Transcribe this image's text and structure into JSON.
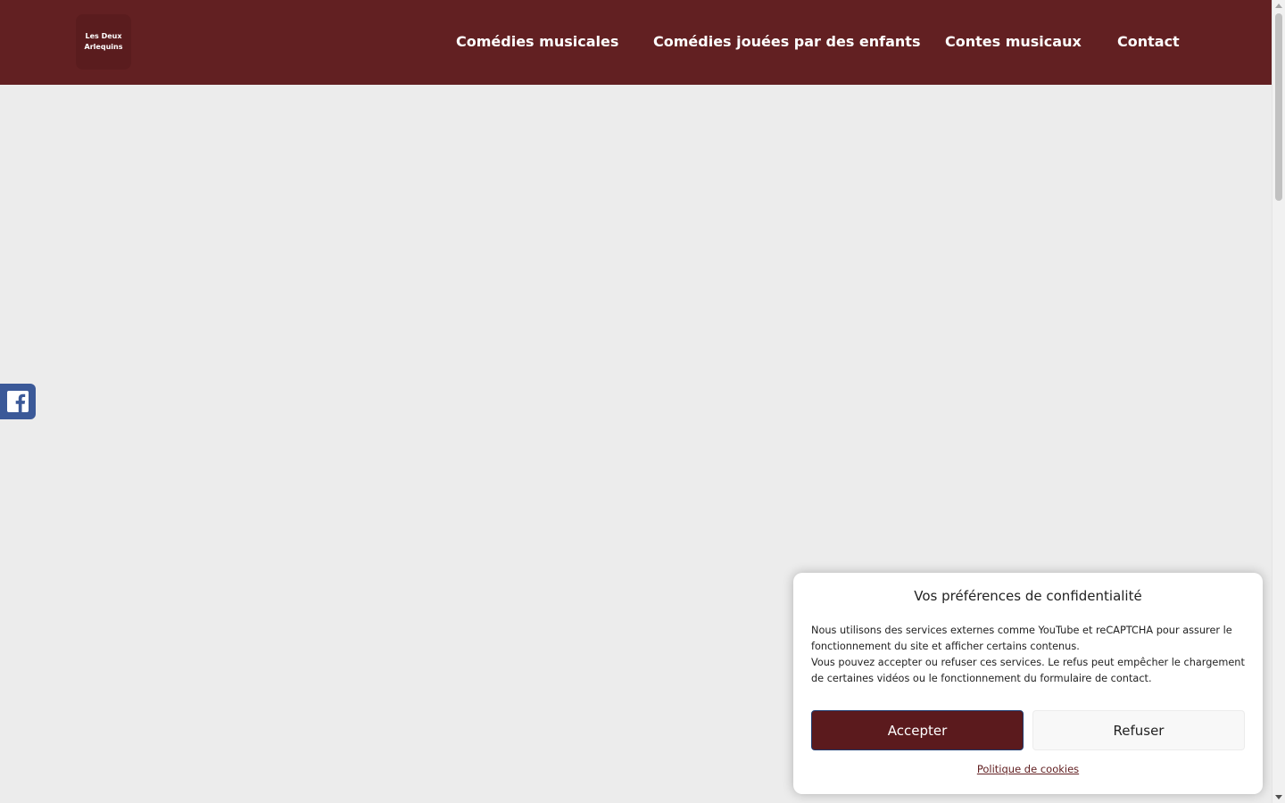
{
  "header": {
    "logo": {
      "line1": "Les Deux",
      "line2": "Arlequins"
    },
    "nav": [
      {
        "label": "Comédies musicales"
      },
      {
        "label": "Comédies jouées par des enfants"
      },
      {
        "label": "Contes musicaux"
      },
      {
        "label": "Contact"
      }
    ]
  },
  "social": {
    "icon": "facebook-icon"
  },
  "cookie_banner": {
    "title": "Vos préférences de confidentialité",
    "paragraph1": "Nous utilisons des services externes comme YouTube et reCAPTCHA pour assurer le fonctionnement du site et afficher certains contenus.",
    "paragraph2": "Vous pouvez accepter ou refuser ces services. Le refus peut empêcher le chargement de certaines vidéos ou le fonctionnement du formulaire de contact.",
    "accept_label": "Accepter",
    "refuse_label": "Refuser",
    "policy_link": "Politique de cookies"
  },
  "colors": {
    "header_bg": "#622022",
    "page_bg": "#ececec",
    "accent": "#5b1a1d",
    "facebook": "#3b5998"
  }
}
